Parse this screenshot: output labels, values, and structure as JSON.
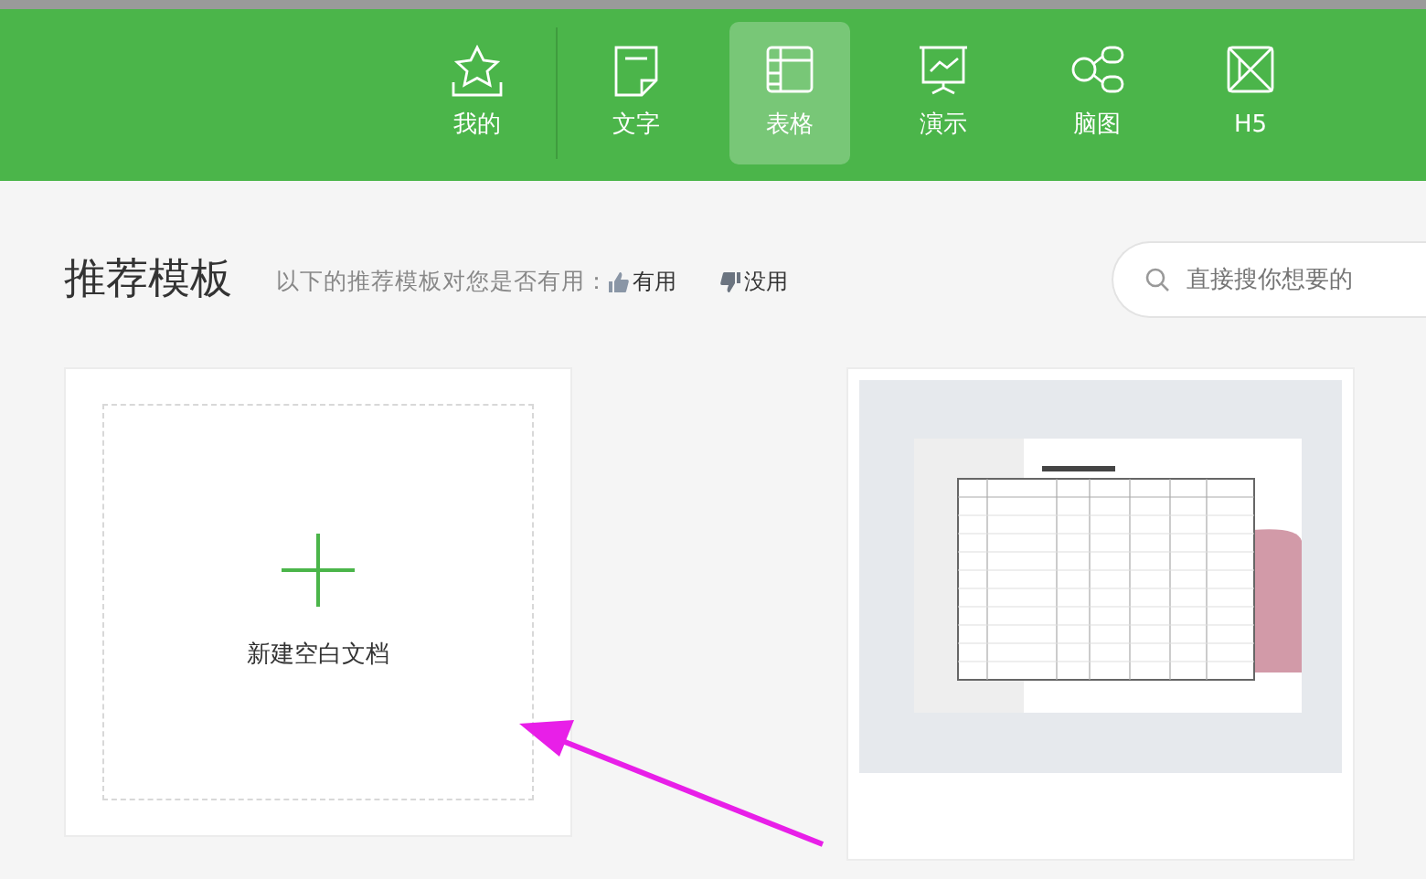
{
  "nav": [
    {
      "label": "我的",
      "selected": false
    },
    {
      "label": "文字",
      "selected": false
    },
    {
      "label": "表格",
      "selected": true
    },
    {
      "label": "演示",
      "selected": false
    },
    {
      "label": "脑图",
      "selected": false
    },
    {
      "label": "H5",
      "selected": false
    }
  ],
  "header": {
    "title": "推荐模板",
    "hint": "以下的推荐模板对您是否有用：",
    "useful": "有用",
    "useless": "没用"
  },
  "search": {
    "placeholder": "直接搜你想要的"
  },
  "blank_card": {
    "label": "新建空白文档"
  }
}
